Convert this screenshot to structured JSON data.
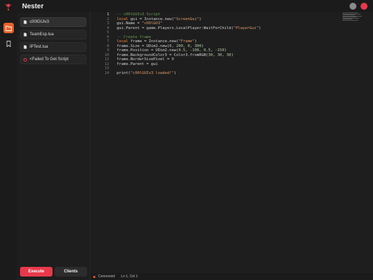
{
  "app": {
    "title": "Nester",
    "accent": "#e8642c",
    "danger": "#e8394b"
  },
  "rail": {
    "items": [
      {
        "icon": "folder-icon",
        "active": true
      },
      {
        "icon": "bookmark-icon",
        "active": false
      }
    ]
  },
  "sidebar": {
    "files": [
      {
        "label": "c00lGUIv3",
        "icon": "file-icon",
        "active": true
      },
      {
        "label": "TeamEsp.lua",
        "icon": "file-icon",
        "active": false
      },
      {
        "label": "IPTest.lua",
        "icon": "file-icon",
        "active": false
      },
      {
        "label": "<Failed To Get Script",
        "icon": "error-icon",
        "active": false
      }
    ],
    "execute_label": "Execute",
    "clients_label": "Clients"
  },
  "editor": {
    "line_numbers": [
      "1",
      "2",
      "3",
      "4",
      "5",
      "6",
      "7",
      "8",
      "9",
      "10",
      "11",
      "12",
      "13",
      "14"
    ],
    "current_line": "1",
    "lines": [
      [
        {
          "t": "-- c00lGUIv3 Script",
          "c": "cm"
        }
      ],
      [
        {
          "t": "local",
          "c": "kw"
        },
        {
          "t": " gui = Instance.new("
        },
        {
          "t": "\"ScreenGui\"",
          "c": "st"
        },
        {
          "t": ")"
        }
      ],
      [
        {
          "t": "gui.Name = "
        },
        {
          "t": "\"c00lGUI\"",
          "c": "st"
        }
      ],
      [
        {
          "t": "gui.Parent = game.Players.LocalPlayer:WaitForChild("
        },
        {
          "t": "\"PlayerGui\"",
          "c": "st"
        },
        {
          "t": ")"
        }
      ],
      [
        {
          "t": ""
        }
      ],
      [
        {
          "t": "-- Create frame",
          "c": "cm"
        }
      ],
      [
        {
          "t": "local",
          "c": "kw"
        },
        {
          "t": " frame = Instance.new("
        },
        {
          "t": "\"Frame\"",
          "c": "st"
        },
        {
          "t": ")"
        }
      ],
      [
        {
          "t": "frame.Size = UDim2.new("
        },
        {
          "t": "0",
          "c": "nm"
        },
        {
          "t": ", "
        },
        {
          "t": "200",
          "c": "nm"
        },
        {
          "t": ", "
        },
        {
          "t": "0",
          "c": "nm"
        },
        {
          "t": ", "
        },
        {
          "t": "300",
          "c": "nm"
        },
        {
          "t": ")"
        }
      ],
      [
        {
          "t": "frame.Position = UDim2.new("
        },
        {
          "t": "0.5",
          "c": "nm"
        },
        {
          "t": ", "
        },
        {
          "t": "-100",
          "c": "nm"
        },
        {
          "t": ", "
        },
        {
          "t": "0.5",
          "c": "nm"
        },
        {
          "t": ", "
        },
        {
          "t": "-150",
          "c": "nm"
        },
        {
          "t": ")"
        }
      ],
      [
        {
          "t": "frame.BackgroundColor3 = Color3.fromRGB("
        },
        {
          "t": "30",
          "c": "nm"
        },
        {
          "t": ", "
        },
        {
          "t": "30",
          "c": "nm"
        },
        {
          "t": ", "
        },
        {
          "t": "30",
          "c": "nm"
        },
        {
          "t": ")"
        }
      ],
      [
        {
          "t": "frame.BorderSizePixel = "
        },
        {
          "t": "0",
          "c": "nm"
        }
      ],
      [
        {
          "t": "frame.Parent = gui"
        }
      ],
      [
        {
          "t": ""
        }
      ],
      [
        {
          "t": "print("
        },
        {
          "t": "\"c00lGUIv3 loaded!\"",
          "c": "st"
        },
        {
          "t": ")"
        }
      ]
    ]
  },
  "status": {
    "connection": "Connected",
    "cursor": "Ln 1, Col 1"
  }
}
